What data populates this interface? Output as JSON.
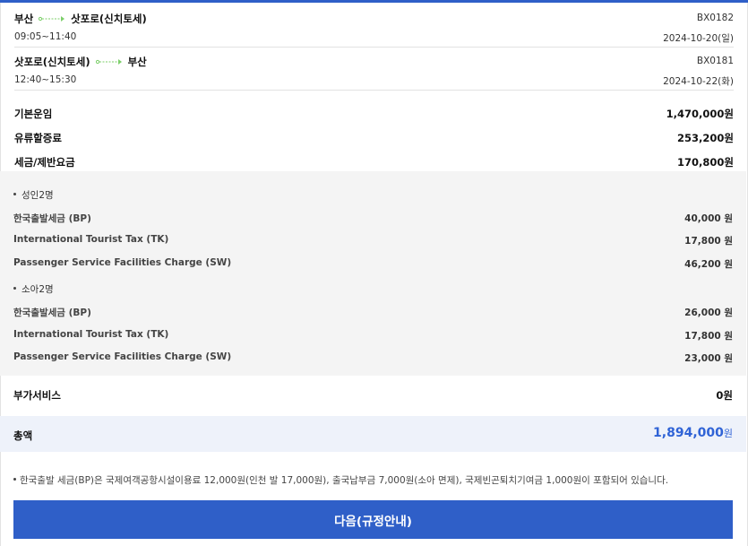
{
  "colors": {
    "accent": "#2f5fc8",
    "total": "#2f63d6",
    "arrow": "#7ccf6a"
  },
  "flights": [
    {
      "from": "부산",
      "to": "삿포로(신치토세)",
      "time": "09:05~11:40",
      "flight_no": "BX0182",
      "date": "2024-10-20(일)"
    },
    {
      "from": "삿포로(신치토세)",
      "to": "부산",
      "time": "12:40~15:30",
      "flight_no": "BX0181",
      "date": "2024-10-22(화)"
    }
  ],
  "fare": {
    "base_label": "기본운임",
    "base_amount": "1,470,000원",
    "fuel_label": "유류할증료",
    "fuel_amount": "253,200원",
    "tax_label": "세금/제반요금",
    "tax_amount": "170,800원"
  },
  "tax_groups": [
    {
      "title": "성인2명",
      "rows": [
        {
          "label": "한국출발세금 (BP)",
          "amount": "40,000 원"
        },
        {
          "label": "International Tourist Tax (TK)",
          "amount": "17,800 원"
        },
        {
          "label": "Passenger Service Facilities Charge (SW)",
          "amount": "46,200 원"
        }
      ]
    },
    {
      "title": "소아2명",
      "rows": [
        {
          "label": "한국출발세금 (BP)",
          "amount": "26,000 원"
        },
        {
          "label": "International Tourist Tax (TK)",
          "amount": "17,800 원"
        },
        {
          "label": "Passenger Service Facilities Charge (SW)",
          "amount": "23,000 원"
        }
      ]
    }
  ],
  "addon": {
    "label": "부가서비스",
    "amount": "0원"
  },
  "total": {
    "label": "총액",
    "amount": "1,894,000",
    "unit": "원"
  },
  "note": "한국출발 세금(BP)은 국제여객공항시설이용료 12,000원(인천 발 17,000원), 출국납부금 7,000원(소아 면제), 국제빈곤퇴치기여금 1,000원이 포함되어 있습니다.",
  "next_button": "다음(규정안내)"
}
